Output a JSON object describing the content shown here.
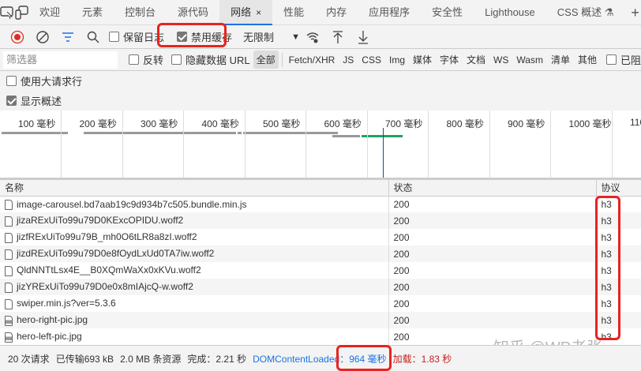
{
  "tabs": {
    "items": [
      "欢迎",
      "元素",
      "控制台",
      "源代码",
      "网络",
      "性能",
      "内存",
      "应用程序",
      "安全性",
      "Lighthouse",
      "CSS 概述"
    ],
    "active": "网络",
    "close": "×",
    "add": "+"
  },
  "toolbar": {
    "preserve_log": "保留日志",
    "disable_cache": "禁用缓存",
    "disable_cache_checked": true,
    "throttle": "无限制"
  },
  "filter": {
    "placeholder": "筛选器",
    "invert": "反转",
    "hide_data_url": "隐藏数据 URL",
    "types": [
      "全部",
      "Fetch/XHR",
      "JS",
      "CSS",
      "Img",
      "媒体",
      "字体",
      "文档",
      "WS",
      "Wasm",
      "清单",
      "其他"
    ],
    "active_type": "全部",
    "blocked": "已阻"
  },
  "options": {
    "big_rows": "使用大请求行",
    "show_overview": "显示概述",
    "show_overview_checked": true
  },
  "overview": {
    "ticks": [
      "100 毫秒",
      "200 毫秒",
      "300 毫秒",
      "400 毫秒",
      "500 毫秒",
      "600 毫秒",
      "700 毫秒",
      "800 毫秒",
      "900 毫秒",
      "1000 毫秒",
      "110"
    ]
  },
  "table": {
    "headers": [
      "名称",
      "状态",
      "协议"
    ],
    "rows": [
      {
        "name": "image-carousel.bd7aab19c9d934b7c505.bundle.min.js",
        "status": "200",
        "protocol": "h3",
        "type": "file"
      },
      {
        "name": "jizaRExUiTo99u79D0KExcOPIDU.woff2",
        "status": "200",
        "protocol": "h3",
        "type": "file"
      },
      {
        "name": "jizfRExUiTo99u79B_mh0O6tLR8a8zI.woff2",
        "status": "200",
        "protocol": "h3",
        "type": "file"
      },
      {
        "name": "jizdRExUiTo99u79D0e8fOydLxUd0TA7iw.woff2",
        "status": "200",
        "protocol": "h3",
        "type": "file"
      },
      {
        "name": "QldNNTtLsx4E__B0XQmWaXx0xKVu.woff2",
        "status": "200",
        "protocol": "h3",
        "type": "file"
      },
      {
        "name": "jizYRExUiTo99u79D0e0x8mIAjcQ-w.woff2",
        "status": "200",
        "protocol": "h3",
        "type": "file"
      },
      {
        "name": "swiper.min.js?ver=5.3.6",
        "status": "200",
        "protocol": "h3",
        "type": "file"
      },
      {
        "name": "hero-right-pic.jpg",
        "status": "200",
        "protocol": "h3",
        "type": "image"
      },
      {
        "name": "hero-left-pic.jpg",
        "status": "200",
        "protocol": "h3",
        "type": "image"
      }
    ]
  },
  "status": {
    "requests": "20 次请求",
    "transferred": "已传输693 kB",
    "resources": "2.0 MB 条资源",
    "finish": "完成：2.21 秒",
    "dcl_label": "DOMContentLoaded：",
    "dcl_value": "964 毫秒",
    "load": "加载：1.83 秒"
  },
  "watermark": "知乎 @WP老张",
  "colors": {
    "accent": "#1a73e8",
    "highlight": "#e8231f",
    "load": "#c5221f",
    "record": "#d93025"
  }
}
